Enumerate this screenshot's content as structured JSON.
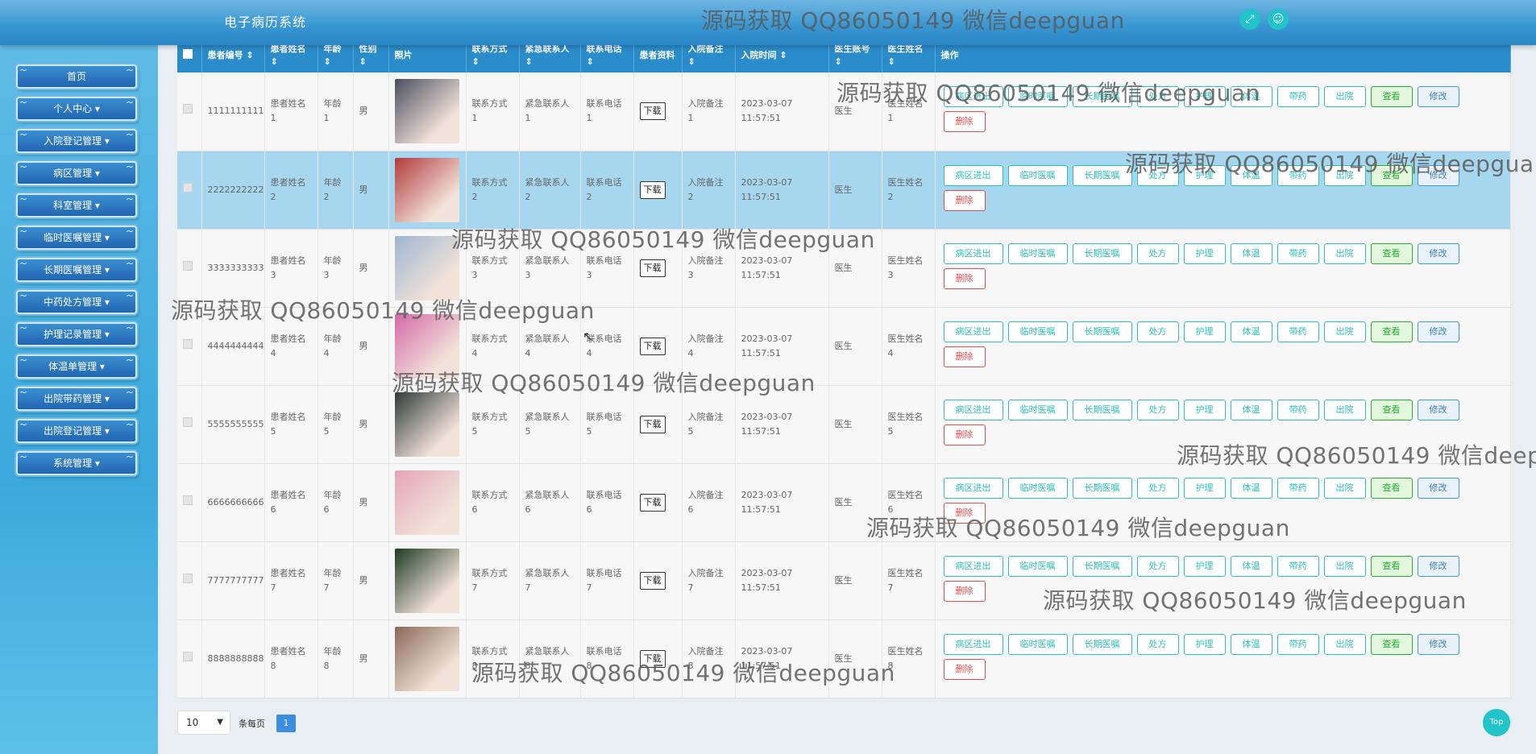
{
  "app": {
    "title": "电子病历系统"
  },
  "header_icons": [
    {
      "name": "fullscreen-icon",
      "glyph": "⤢"
    },
    {
      "name": "user-icon",
      "glyph": "👤"
    }
  ],
  "sidebar": {
    "items": [
      {
        "label": "首页"
      },
      {
        "label": "个人中心 ▾"
      },
      {
        "label": "入院登记管理 ▾"
      },
      {
        "label": "病区管理 ▾"
      },
      {
        "label": "科室管理 ▾"
      },
      {
        "label": "临时医嘱管理 ▾"
      },
      {
        "label": "长期医嘱管理 ▾"
      },
      {
        "label": "中药处方管理 ▾"
      },
      {
        "label": "护理记录管理 ▾"
      },
      {
        "label": "体温单管理 ▾"
      },
      {
        "label": "出院带药管理 ▾"
      },
      {
        "label": "出院登记管理 ▾"
      },
      {
        "label": "系统管理 ▾"
      }
    ]
  },
  "table": {
    "columns": [
      "",
      "患者编号 ⇕",
      "患者姓名 ⇕",
      "年龄 ⇕",
      "性别 ⇕",
      "照片",
      "联系方式 ⇕",
      "紧急联系人 ⇕",
      "联系电话 ⇕",
      "患者资料",
      "入院备注 ⇕",
      "入院时间 ⇕",
      "医生账号 ⇕",
      "医生姓名 ⇕",
      "操作"
    ],
    "rows": [
      {
        "id": "1111111111",
        "name": "患者姓名 1",
        "age": "年龄 1",
        "gender": "男",
        "contact": "联系方式 1",
        "emergency": "紧急联系人 1",
        "phone": "联系电话 1",
        "doc": "下载",
        "note": "入院备注 1",
        "time": "2023-03-07 11:57:51",
        "doctor_account": "医生",
        "doctor_name": "医生姓名 1",
        "photo_color": "#4a4f5e"
      },
      {
        "id": "2222222222",
        "name": "患者姓名 2",
        "age": "年龄 2",
        "gender": "男",
        "contact": "联系方式 2",
        "emergency": "紧急联系人 2",
        "phone": "联系电话 2",
        "doc": "下载",
        "note": "入院备注 2",
        "time": "2023-03-07 11:57:51",
        "doctor_account": "医生",
        "doctor_name": "医生姓名 2",
        "photo_color": "#b23a3a"
      },
      {
        "id": "3333333333",
        "name": "患者姓名 3",
        "age": "年龄 3",
        "gender": "男",
        "contact": "联系方式 3",
        "emergency": "紧急联系人 3",
        "phone": "联系电话 3",
        "doc": "下载",
        "note": "入院备注 3",
        "time": "2023-03-07 11:57:51",
        "doctor_account": "医生",
        "doctor_name": "医生姓名 3",
        "photo_color": "#9fb6cf"
      },
      {
        "id": "4444444444",
        "name": "患者姓名 4",
        "age": "年龄 4",
        "gender": "男",
        "contact": "联系方式 4",
        "emergency": "紧急联系人 4",
        "phone": "联系电话 4",
        "doc": "下载",
        "note": "入院备注 4",
        "time": "2023-03-07 11:57:51",
        "doctor_account": "医生",
        "doctor_name": "医生姓名 4",
        "photo_color": "#d46aa7"
      },
      {
        "id": "5555555555",
        "name": "患者姓名 5",
        "age": "年龄 5",
        "gender": "男",
        "contact": "联系方式 5",
        "emergency": "紧急联系人 5",
        "phone": "联系电话 5",
        "doc": "下载",
        "note": "入院备注 5",
        "time": "2023-03-07 11:57:51",
        "doctor_account": "医生",
        "doctor_name": "医生姓名 5",
        "photo_color": "#2f3b3a"
      },
      {
        "id": "6666666666",
        "name": "患者姓名 6",
        "age": "年龄 6",
        "gender": "男",
        "contact": "联系方式 6",
        "emergency": "紧急联系人 6",
        "phone": "联系电话 6",
        "doc": "下载",
        "note": "入院备注 6",
        "time": "2023-03-07 11:57:51",
        "doctor_account": "医生",
        "doctor_name": "医生姓名 6",
        "photo_color": "#e5a5b8"
      },
      {
        "id": "7777777777",
        "name": "患者姓名 7",
        "age": "年龄 7",
        "gender": "男",
        "contact": "联系方式 7",
        "emergency": "紧急联系人 7",
        "phone": "联系电话 7",
        "doc": "下载",
        "note": "入院备注 7",
        "time": "2023-03-07 11:57:51",
        "doctor_account": "医生",
        "doctor_name": "医生姓名 7",
        "photo_color": "#1f3a22"
      },
      {
        "id": "8888888888",
        "name": "患者姓名 8",
        "age": "年龄 8",
        "gender": "男",
        "contact": "联系方式 8",
        "emergency": "紧急联系人 8",
        "phone": "联系电话 8",
        "doc": "下载",
        "note": "入院备注 8",
        "time": "2023-03-07 11:57:51",
        "doctor_account": "医生",
        "doctor_name": "医生姓名 8",
        "photo_color": "#8a6a55"
      }
    ],
    "actions": [
      {
        "label": "病区进出",
        "kind": "op"
      },
      {
        "label": "临时医嘱",
        "kind": "op"
      },
      {
        "label": "长期医嘱",
        "kind": "op"
      },
      {
        "label": "处方",
        "kind": "op"
      },
      {
        "label": "护理",
        "kind": "op"
      },
      {
        "label": "体温",
        "kind": "op"
      },
      {
        "label": "带药",
        "kind": "op"
      },
      {
        "label": "出院",
        "kind": "op"
      },
      {
        "label": "查看",
        "kind": "view"
      },
      {
        "label": "修改",
        "kind": "edit"
      },
      {
        "label": "删除",
        "kind": "del"
      }
    ],
    "selected_row": 1
  },
  "pagination": {
    "page_size": "10",
    "page_size_label": "条每页",
    "current_page": "1"
  },
  "top_button": "Top",
  "watermark_text": "源码获取 QQ86050149 微信deepguan"
}
